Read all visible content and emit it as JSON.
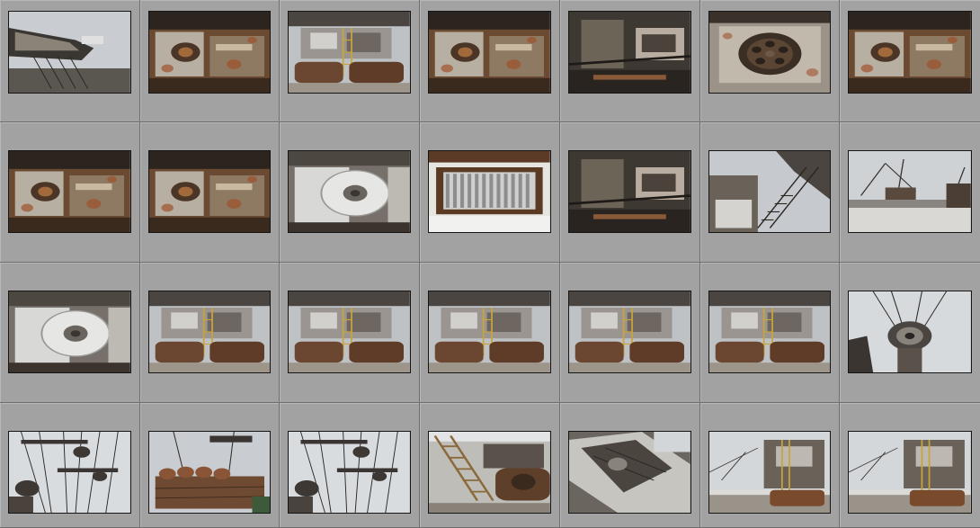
{
  "grid": {
    "columns": 7,
    "rows": 4,
    "background_color": "#a3a3a3",
    "divider_color": "#6e6e6e"
  },
  "thumbnails": [
    {
      "scene": "sky-boom"
    },
    {
      "scene": "machinery-rust"
    },
    {
      "scene": "tread-machine"
    },
    {
      "scene": "machinery-rust"
    },
    {
      "scene": "machinery-dark"
    },
    {
      "scene": "wheel-hub"
    },
    {
      "scene": "machinery-rust"
    },
    {
      "scene": "machinery-rust"
    },
    {
      "scene": "machinery-rust"
    },
    {
      "scene": "white-drum"
    },
    {
      "scene": "radiator"
    },
    {
      "scene": "machinery-dark"
    },
    {
      "scene": "stairs-sky"
    },
    {
      "scene": "field-cranes"
    },
    {
      "scene": "white-drum"
    },
    {
      "scene": "tread-machine"
    },
    {
      "scene": "tread-machine"
    },
    {
      "scene": "tread-machine"
    },
    {
      "scene": "tread-machine"
    },
    {
      "scene": "tread-machine"
    },
    {
      "scene": "pulley-sky"
    },
    {
      "scene": "cables-sky"
    },
    {
      "scene": "bucket-wheel"
    },
    {
      "scene": "cables-sky"
    },
    {
      "scene": "stairs-tread"
    },
    {
      "scene": "tilted-boom"
    },
    {
      "scene": "tower-snow"
    },
    {
      "scene": "tower-snow"
    }
  ]
}
